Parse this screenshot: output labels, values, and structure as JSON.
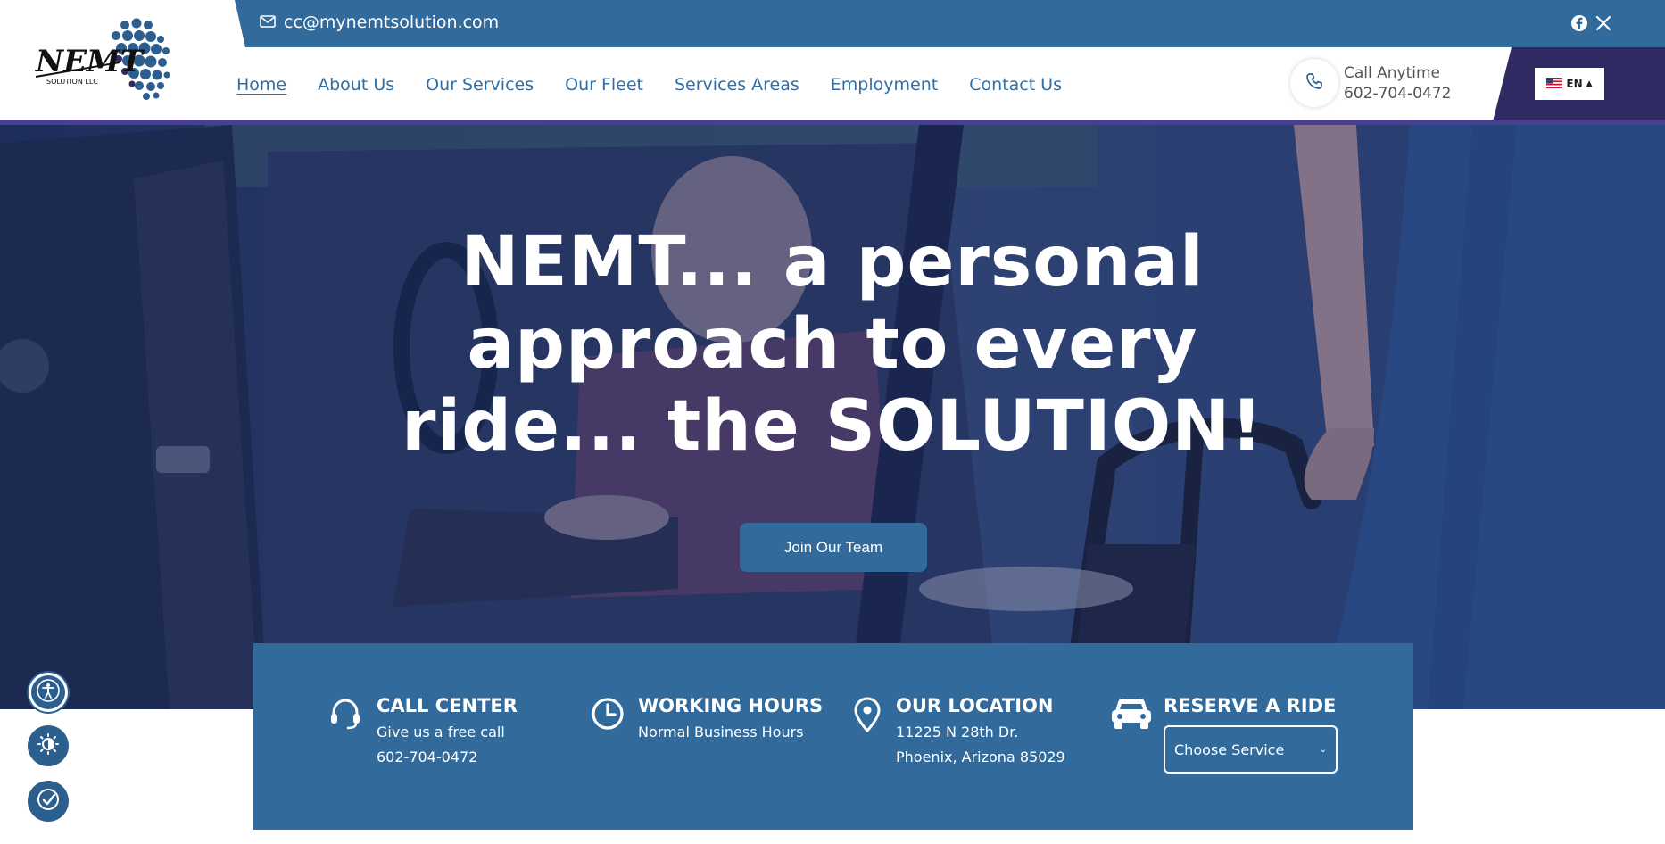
{
  "topbar": {
    "email": "cc@mynemtsolution.com"
  },
  "logo": {
    "brand": "NEMT",
    "sub": "SOLUTION LLC"
  },
  "nav": {
    "items": [
      "Home",
      "About Us",
      "Our Services",
      "Our Fleet",
      "Services Areas",
      "Employment",
      "Contact Us"
    ],
    "active": "Home"
  },
  "header_call": {
    "label": "Call Anytime",
    "number": "602-704-0472"
  },
  "language": {
    "code": "EN"
  },
  "hero": {
    "title_lines": [
      "NEMT... a personal",
      "approach to every",
      "ride... the SOLUTION!"
    ],
    "button": "Join Our Team"
  },
  "info": {
    "call_center": {
      "title": "CALL CENTER",
      "line1": "Give us a free call",
      "line2": "602-704-0472"
    },
    "working_hours": {
      "title": "WORKING HOURS",
      "line1": "Normal Business Hours"
    },
    "location": {
      "title": "OUR LOCATION",
      "line1": "11225 N 28th Dr.",
      "line2": "Phoenix, Arizona 85029"
    },
    "reserve": {
      "title": "RESERVE A RIDE",
      "select_value": "Choose Service"
    }
  },
  "colors": {
    "primary": "#316a9b",
    "accent_purple": "#2f2a62",
    "nav_link": "#2f6fa6"
  }
}
